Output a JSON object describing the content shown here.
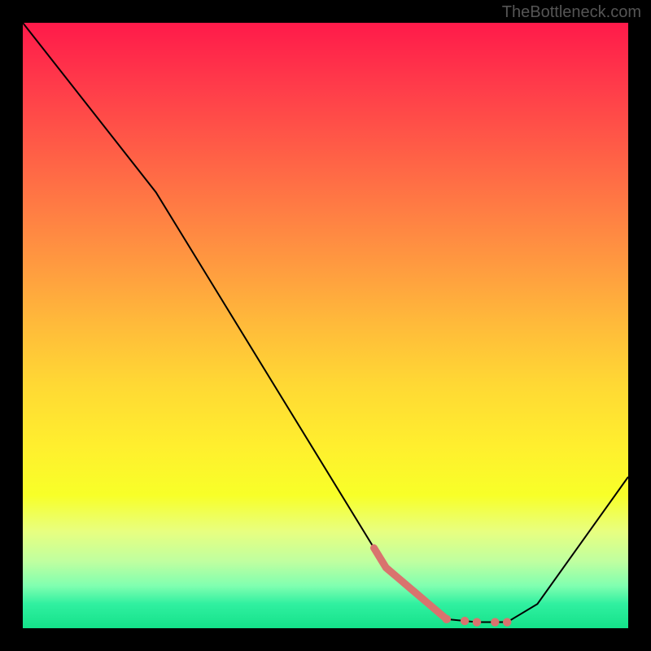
{
  "watermark": "TheBottleneck.com",
  "chart_data": {
    "type": "line",
    "title": "",
    "xlabel": "",
    "ylabel": "",
    "xlim": [
      0,
      100
    ],
    "ylim": [
      0,
      100
    ],
    "gradient_note": "background vertical gradient red→yellow→green representing bottleneck severity (red=high, green=low)",
    "series": [
      {
        "name": "bottleneck-curve",
        "x": [
          0,
          22,
          60,
          70,
          75,
          80,
          85,
          100
        ],
        "values": [
          100,
          72,
          10,
          1.5,
          1,
          1,
          4,
          25
        ]
      }
    ],
    "markers": {
      "name": "highlight-segment",
      "color": "#d9736e",
      "x_start": 58,
      "x_end": 80,
      "note": "thick coral overlay on the curve descending into the minimum, plus a few dots along the flat bottom"
    }
  }
}
